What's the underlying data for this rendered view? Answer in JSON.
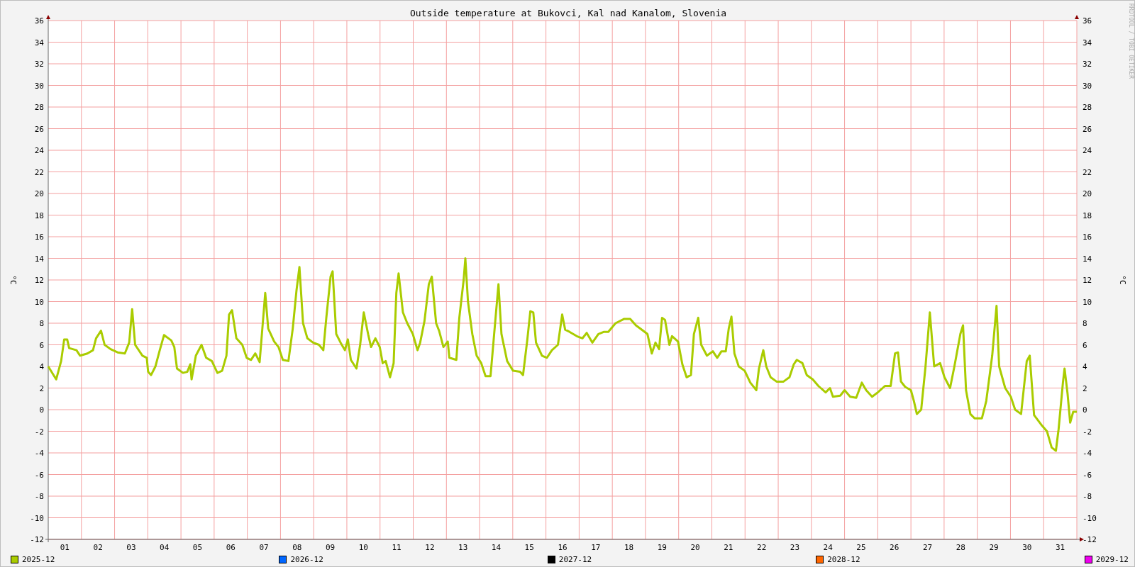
{
  "chart": {
    "credit": "RRDTOOL / TOBI OETIKER",
    "right_ylabel": "°C",
    "right_yticks": [
      "36",
      "34",
      "32",
      "30",
      "28",
      "26",
      "24",
      "22",
      "20",
      "18",
      "16",
      "14",
      "12",
      "10",
      "8",
      "6",
      "4",
      "2",
      "0",
      "-2",
      "-4",
      "-6",
      "-8",
      "-10",
      "-12"
    ],
    "chart_data": {
      "type": "line",
      "title": "Outside temperature at Bukovci, Kal nad Kanalom, Slovenia",
      "ylabel": "°C",
      "xlim": [
        1,
        32
      ],
      "ylim": [
        -12,
        36
      ],
      "grid": true,
      "yticks": [
        -12,
        -10,
        -8,
        -6,
        -4,
        -2,
        0,
        2,
        4,
        6,
        8,
        10,
        12,
        14,
        16,
        18,
        20,
        22,
        24,
        26,
        28,
        30,
        32,
        34,
        36
      ],
      "xticks": [
        {
          "value": 1.5,
          "label": "01"
        },
        {
          "value": 2.5,
          "label": "02"
        },
        {
          "value": 3.5,
          "label": "03"
        },
        {
          "value": 4.5,
          "label": "04"
        },
        {
          "value": 5.5,
          "label": "05"
        },
        {
          "value": 6.5,
          "label": "06"
        },
        {
          "value": 7.5,
          "label": "07"
        },
        {
          "value": 8.5,
          "label": "08"
        },
        {
          "value": 9.5,
          "label": "09"
        },
        {
          "value": 10.5,
          "label": "10"
        },
        {
          "value": 11.5,
          "label": "11"
        },
        {
          "value": 12.5,
          "label": "12"
        },
        {
          "value": 13.5,
          "label": "13"
        },
        {
          "value": 14.5,
          "label": "14"
        },
        {
          "value": 15.5,
          "label": "15"
        },
        {
          "value": 16.5,
          "label": "16"
        },
        {
          "value": 17.5,
          "label": "17"
        },
        {
          "value": 18.5,
          "label": "18"
        },
        {
          "value": 19.5,
          "label": "19"
        },
        {
          "value": 20.5,
          "label": "20"
        },
        {
          "value": 21.5,
          "label": "21"
        },
        {
          "value": 22.5,
          "label": "22"
        },
        {
          "value": 23.5,
          "label": "23"
        },
        {
          "value": 24.5,
          "label": "24"
        },
        {
          "value": 25.5,
          "label": "25"
        },
        {
          "value": 26.5,
          "label": "26"
        },
        {
          "value": 27.5,
          "label": "27"
        },
        {
          "value": 28.5,
          "label": "28"
        },
        {
          "value": 29.5,
          "label": "29"
        },
        {
          "value": 30.5,
          "label": "30"
        },
        {
          "value": 31.5,
          "label": "31"
        }
      ],
      "x": [
        1.0,
        1.24,
        1.39,
        1.48,
        1.57,
        1.63,
        1.85,
        1.96,
        2.18,
        2.35,
        2.44,
        2.59,
        2.7,
        2.88,
        3.09,
        3.31,
        3.44,
        3.53,
        3.62,
        3.84,
        3.97,
        4.01,
        4.1,
        4.23,
        4.36,
        4.49,
        4.71,
        4.8,
        4.88,
        5.06,
        5.19,
        5.28,
        5.32,
        5.45,
        5.62,
        5.76,
        5.93,
        6.1,
        6.24,
        6.37,
        6.45,
        6.54,
        6.67,
        6.85,
        6.98,
        7.11,
        7.24,
        7.37,
        7.46,
        7.54,
        7.63,
        7.81,
        7.94,
        8.07,
        8.24,
        8.37,
        8.48,
        8.57,
        8.68,
        8.81,
        8.98,
        9.16,
        9.29,
        9.38,
        9.51,
        9.57,
        9.68,
        9.81,
        9.94,
        10.03,
        10.12,
        10.29,
        10.4,
        10.51,
        10.64,
        10.73,
        10.86,
        10.99,
        11.08,
        11.17,
        11.3,
        11.41,
        11.49,
        11.56,
        11.69,
        11.82,
        11.99,
        12.13,
        12.21,
        12.34,
        12.47,
        12.56,
        12.69,
        12.78,
        12.91,
        13.04,
        13.09,
        13.3,
        13.39,
        13.52,
        13.57,
        13.65,
        13.78,
        13.91,
        14.05,
        14.18,
        14.33,
        14.44,
        14.57,
        14.66,
        14.83,
        15.01,
        15.22,
        15.31,
        15.44,
        15.53,
        15.62,
        15.7,
        15.88,
        16.03,
        16.18,
        16.36,
        16.49,
        16.58,
        16.71,
        16.93,
        17.1,
        17.23,
        17.4,
        17.58,
        17.75,
        17.88,
        18.1,
        18.36,
        18.54,
        18.71,
        18.89,
        19.06,
        19.19,
        19.3,
        19.41,
        19.5,
        19.59,
        19.72,
        19.8,
        19.98,
        20.11,
        20.24,
        20.37,
        20.46,
        20.59,
        20.68,
        20.85,
        21.03,
        21.16,
        21.29,
        21.42,
        21.51,
        21.59,
        21.68,
        21.81,
        21.99,
        22.16,
        22.34,
        22.42,
        22.55,
        22.64,
        22.77,
        22.95,
        23.16,
        23.34,
        23.47,
        23.56,
        23.73,
        23.86,
        24.04,
        24.21,
        24.43,
        24.56,
        24.65,
        24.87,
        25.0,
        25.17,
        25.35,
        25.52,
        25.65,
        25.83,
        26.0,
        26.22,
        26.39,
        26.52,
        26.61,
        26.7,
        26.83,
        27.0,
        27.09,
        27.18,
        27.31,
        27.44,
        27.57,
        27.7,
        27.88,
        28.01,
        28.18,
        28.31,
        28.49,
        28.57,
        28.66,
        28.79,
        28.92,
        29.14,
        29.27,
        29.45,
        29.58,
        29.66,
        29.84,
        30.01,
        30.14,
        30.32,
        30.49,
        30.58,
        30.71,
        30.93,
        31.1,
        31.24,
        31.37,
        31.45,
        31.58,
        31.63,
        31.72,
        31.8,
        31.89,
        32.0
      ],
      "series": [
        {
          "name": "2025-12",
          "color": "#aacc00",
          "values": [
            4,
            2.8,
            4.5,
            6.5,
            6.5,
            5.7,
            5.5,
            5.0,
            5.2,
            5.5,
            6.6,
            7.3,
            6.0,
            5.6,
            5.3,
            5.2,
            6.2,
            9.3,
            6.0,
            5.0,
            4.8,
            3.5,
            3.2,
            4.0,
            5.5,
            6.9,
            6.4,
            5.8,
            3.8,
            3.4,
            3.5,
            4.2,
            2.8,
            5.0,
            6.0,
            4.8,
            4.5,
            3.4,
            3.6,
            5.0,
            8.8,
            9.2,
            6.6,
            6.0,
            4.8,
            4.6,
            5.2,
            4.4,
            7.8,
            10.8,
            7.5,
            6.3,
            5.8,
            4.6,
            4.5,
            7.5,
            11.0,
            13.2,
            8.0,
            6.6,
            6.2,
            6.0,
            5.5,
            8.5,
            12.3,
            12.8,
            7.0,
            6.2,
            5.5,
            6.5,
            4.6,
            3.8,
            6.0,
            9.0,
            7.0,
            5.8,
            6.6,
            5.8,
            4.3,
            4.5,
            3.0,
            4.3,
            10.8,
            12.6,
            9.0,
            8.0,
            7.0,
            5.5,
            6.2,
            8.2,
            11.6,
            12.3,
            8.0,
            7.3,
            5.8,
            6.3,
            4.8,
            4.6,
            8.5,
            12.0,
            14.0,
            10.0,
            7.0,
            5.0,
            4.3,
            3.1,
            3.1,
            7.0,
            11.6,
            7.0,
            4.5,
            3.6,
            3.5,
            3.2,
            6.5,
            9.1,
            9.0,
            6.2,
            5.0,
            4.8,
            5.5,
            6.0,
            8.8,
            7.4,
            7.2,
            6.8,
            6.6,
            7.1,
            6.2,
            7.0,
            7.2,
            7.2,
            8.0,
            8.4,
            8.4,
            7.8,
            7.4,
            7.0,
            5.2,
            6.2,
            5.6,
            8.5,
            8.3,
            6.0,
            6.8,
            6.3,
            4.2,
            3.0,
            3.2,
            7.0,
            8.5,
            6.0,
            5.0,
            5.4,
            4.8,
            5.4,
            5.4,
            7.5,
            8.6,
            5.2,
            4.0,
            3.6,
            2.5,
            1.8,
            3.8,
            5.5,
            4.0,
            3.0,
            2.6,
            2.6,
            3.0,
            4.2,
            4.6,
            4.3,
            3.2,
            2.8,
            2.2,
            1.6,
            2.0,
            1.2,
            1.3,
            1.8,
            1.2,
            1.1,
            2.5,
            1.8,
            1.2,
            1.6,
            2.2,
            2.2,
            5.2,
            5.3,
            2.6,
            2.1,
            1.8,
            0.8,
            -0.4,
            0.0,
            4.0,
            9.0,
            4.0,
            4.3,
            3.0,
            2.0,
            4.0,
            7.0,
            7.8,
            1.8,
            -0.4,
            -0.8,
            -0.8,
            0.8,
            5.0,
            9.6,
            4.0,
            2.0,
            1.2,
            0.0,
            -0.4,
            4.5,
            5.0,
            -0.5,
            -1.4,
            -2.0,
            -3.5,
            -3.8,
            -1.8,
            2.5,
            3.8,
            1.5,
            -1.2,
            -0.2,
            -0.2
          ]
        }
      ]
    }
  },
  "legend": [
    {
      "label": "2026-12",
      "color": "#0066ff"
    },
    {
      "label": "2027-12",
      "color": "#000000"
    },
    {
      "label": "2028-12",
      "color": "#ff6600"
    },
    {
      "label": "2029-12",
      "color": "#ee00ee"
    }
  ]
}
